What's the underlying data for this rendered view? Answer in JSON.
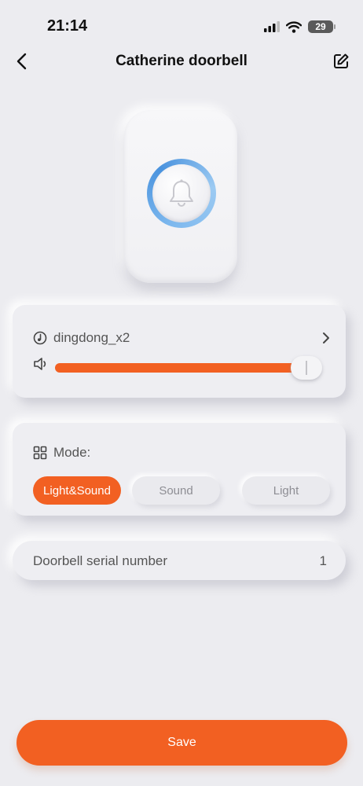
{
  "status_bar": {
    "time": "21:14",
    "battery": "29"
  },
  "header": {
    "title": "Catherine doorbell"
  },
  "sound": {
    "ringtone": "dingdong_x2",
    "volume_percent": 97
  },
  "mode": {
    "label": "Mode:",
    "options": [
      "Light&Sound",
      "Sound",
      "Light"
    ],
    "selected": "Light&Sound"
  },
  "serial": {
    "label": "Doorbell serial number",
    "value": "1"
  },
  "actions": {
    "save_label": "Save"
  },
  "colors": {
    "accent": "#F26022",
    "background": "#ECECF0",
    "ring": "#4A93DE"
  },
  "icons": {
    "back": "chevron-left-icon",
    "edit": "edit-icon",
    "ringtone": "music-note-icon",
    "volume": "speaker-icon",
    "mode": "grid-icon",
    "chevron": "chevron-right-icon",
    "bell": "bell-icon"
  }
}
